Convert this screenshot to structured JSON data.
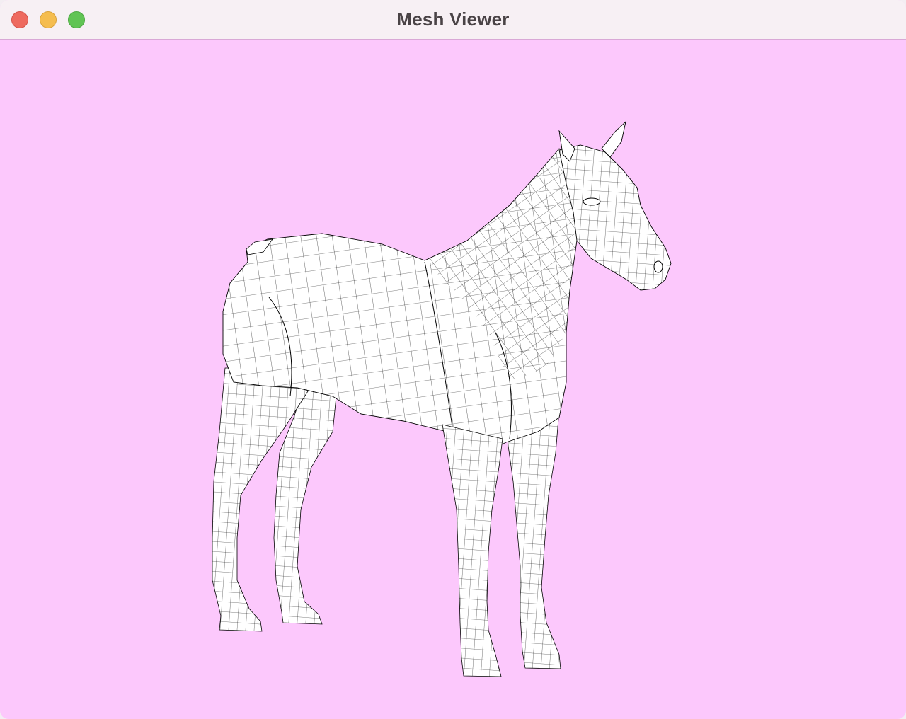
{
  "window": {
    "title": "Mesh Viewer"
  },
  "controls": {
    "close": "close-button",
    "minimize": "minimize-button",
    "zoom": "zoom-button"
  },
  "colors": {
    "background": "#fcc8fc",
    "titlebar": "#f7f0f4",
    "mesh_fill": "#ffffff",
    "mesh_line": "#000000",
    "close": "#ee6a5f",
    "minimize": "#f5bd4f",
    "zoom": "#61c454"
  },
  "viewport": {
    "model": "horse",
    "render_mode": "wireframe"
  }
}
